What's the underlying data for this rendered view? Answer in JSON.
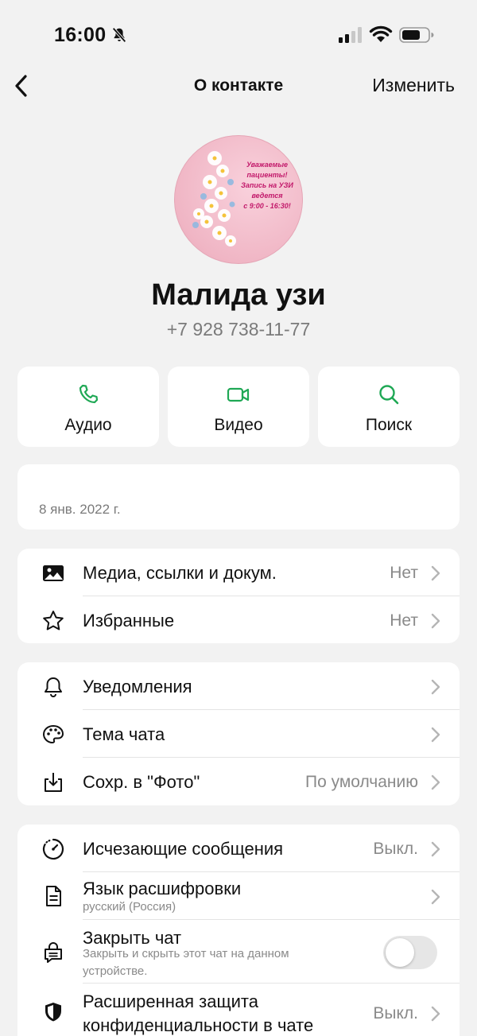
{
  "status_bar": {
    "time": "16:00",
    "icons": [
      "bell-slash-icon",
      "signal-icon",
      "wifi-icon",
      "battery-icon"
    ]
  },
  "nav": {
    "title": "О контакте",
    "edit_label": "Изменить",
    "back_icon": "chevron-left-icon"
  },
  "avatar": {
    "lines": [
      "Уважаемые",
      "пациенты!",
      "Запись на УЗИ",
      "ведется",
      "с 9:00 - 16:30!"
    ]
  },
  "contact": {
    "name": "Малида узи",
    "phone": "+7 928 738-11-77"
  },
  "actions": [
    {
      "label": "Аудио",
      "icon": "phone-icon"
    },
    {
      "label": "Видео",
      "icon": "video-icon"
    },
    {
      "label": "Поиск",
      "icon": "search-icon"
    }
  ],
  "date_card": {
    "date": "8 янв. 2022 г."
  },
  "media_section": [
    {
      "label": "Медиа, ссылки и докум.",
      "value": "Нет",
      "icon": "image-icon"
    },
    {
      "label": "Избранные",
      "value": "Нет",
      "icon": "star-icon"
    }
  ],
  "settings_section": [
    {
      "label": "Уведомления",
      "value": "",
      "icon": "bell-icon"
    },
    {
      "label": "Тема чата",
      "value": "",
      "icon": "palette-icon"
    },
    {
      "label": "Сохр. в \"Фото\"",
      "value": "По умолчанию",
      "icon": "save-download-icon"
    }
  ],
  "privacy_section": [
    {
      "label": "Исчезающие сообщения",
      "value": "Выкл.",
      "icon": "timer-icon"
    },
    {
      "label": "Язык расшифровки",
      "sub": "русский (Россия)",
      "value": "",
      "icon": "document-icon"
    },
    {
      "label": "Закрыть чат",
      "sub1": "Закрыть и скрыть этот чат на данном",
      "sub2": "устройстве.",
      "toggle_on": false,
      "icon": "lock-chat-icon"
    },
    {
      "label": "Расширенная защита",
      "label2": "конфиденциальности в чате",
      "value": "Выкл.",
      "icon": "shield-icon"
    }
  ],
  "colors": {
    "accent": "#1fa855",
    "background": "#f2f2f2",
    "card": "#ffffff"
  }
}
